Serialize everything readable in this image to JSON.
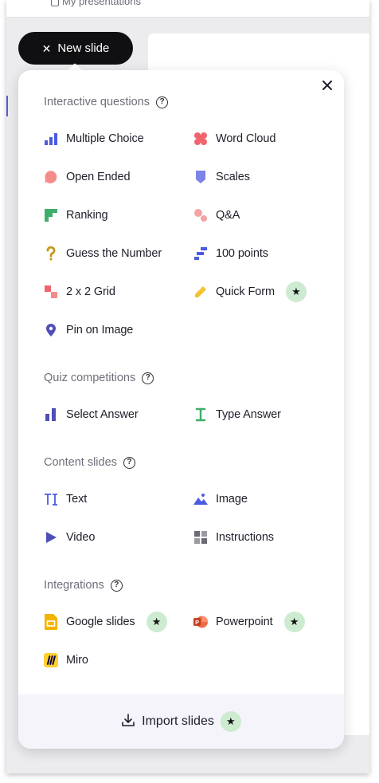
{
  "background": {
    "breadcrumb_label": "My presentations"
  },
  "new_slide_button": {
    "label": "New slide",
    "icon": "close-x-icon"
  },
  "panel": {
    "close_icon": "close-icon",
    "sections": [
      {
        "title": "Interactive questions",
        "help_icon": "help-icon",
        "items": [
          {
            "label": "Multiple Choice",
            "icon": "bar-chart-icon",
            "color": "#4a5be0",
            "premium": false
          },
          {
            "label": "Word Cloud",
            "icon": "cloud-icon",
            "color": "#f0646e",
            "premium": false
          },
          {
            "label": "Open Ended",
            "icon": "speech-bubble-icon",
            "color": "#f48c8c",
            "premium": false
          },
          {
            "label": "Scales",
            "icon": "shield-icon",
            "color": "#7d84e6",
            "premium": false
          },
          {
            "label": "Ranking",
            "icon": "ranking-icon",
            "color": "#3fae6a",
            "premium": false
          },
          {
            "label": "Q&A",
            "icon": "qa-bubbles-icon",
            "color": "#f4a3a3",
            "premium": false
          },
          {
            "label": "Guess the Number",
            "icon": "question-mark-icon",
            "color": "#c79a1f",
            "premium": false
          },
          {
            "label": "100 points",
            "icon": "steps-icon",
            "color": "#4a5be0",
            "premium": false
          },
          {
            "label": "2 x 2 Grid",
            "icon": "grid-squares-icon",
            "color": "#f0646e",
            "premium": false
          },
          {
            "label": "Quick Form",
            "icon": "pencil-icon",
            "color": "#f4c430",
            "premium": true
          },
          {
            "label": "Pin on Image",
            "icon": "map-pin-icon",
            "color": "#4e4fb8",
            "premium": false
          }
        ]
      },
      {
        "title": "Quiz competitions",
        "help_icon": "help-icon",
        "items": [
          {
            "label": "Select Answer",
            "icon": "bar-chart-icon",
            "color": "#4e4fb8",
            "premium": false
          },
          {
            "label": "Type Answer",
            "icon": "text-cursor-icon",
            "color": "#3fae6a",
            "premium": false
          }
        ]
      },
      {
        "title": "Content slides",
        "help_icon": "help-icon",
        "items": [
          {
            "label": "Text",
            "icon": "text-type-icon",
            "color": "#4a5be0",
            "premium": false
          },
          {
            "label": "Image",
            "icon": "image-mountain-icon",
            "color": "#4a5be0",
            "premium": false
          },
          {
            "label": "Video",
            "icon": "play-icon",
            "color": "#4e4fb8",
            "premium": false
          },
          {
            "label": "Instructions",
            "icon": "instructions-grid-icon",
            "color": "#6b6b75",
            "premium": false
          }
        ]
      },
      {
        "title": "Integrations",
        "help_icon": "help-icon",
        "items": [
          {
            "label": "Google slides",
            "icon": "google-slides-icon",
            "color": "#f4b400",
            "premium": true
          },
          {
            "label": "Powerpoint",
            "icon": "powerpoint-icon",
            "color": "#d24726",
            "premium": true
          },
          {
            "label": "Miro",
            "icon": "miro-icon",
            "color": "#ffd02f",
            "premium": false
          }
        ]
      }
    ],
    "footer": {
      "label": "Import slides",
      "icon": "download-icon",
      "premium": true
    },
    "premium_icon": "star-icon"
  }
}
